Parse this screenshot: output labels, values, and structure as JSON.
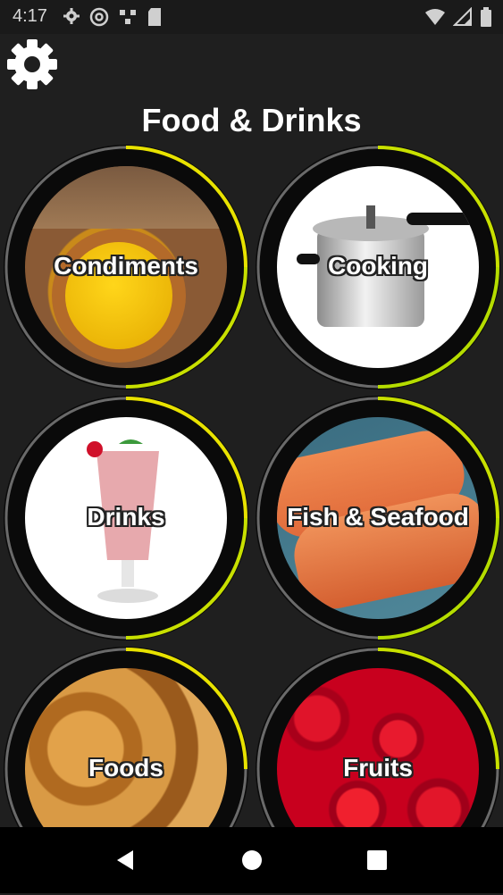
{
  "status_bar": {
    "time": "4:17",
    "left_icons": [
      "gear-icon",
      "at-sign-icon",
      "sync-icon",
      "sd-card-icon"
    ],
    "right_icons": [
      "wifi-icon",
      "signal-icon",
      "battery-icon"
    ]
  },
  "header": {
    "title": "Food & Drinks",
    "settings_icon": "gear-icon"
  },
  "categories": [
    {
      "label": "Condiments"
    },
    {
      "label": "Cooking"
    },
    {
      "label": "Drinks"
    },
    {
      "label": "Fish & Seafood"
    },
    {
      "label": "Foods"
    },
    {
      "label": "Fruits"
    }
  ],
  "colors": {
    "background": "#1f1f1f",
    "ring_black": "#0a0a0a",
    "ring_accent": "#e8e200",
    "ring_gray": "#6a6a6a"
  },
  "nav": {
    "buttons": [
      "back-icon",
      "home-icon",
      "recents-icon"
    ]
  }
}
